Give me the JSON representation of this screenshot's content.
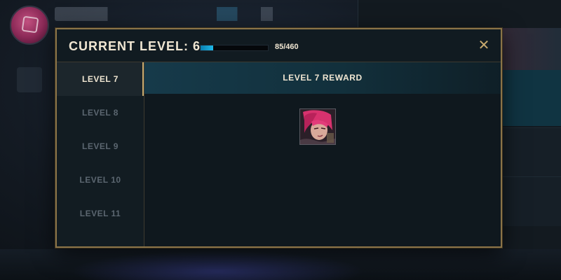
{
  "modal": {
    "title": "CURRENT LEVEL: 6",
    "xp": {
      "current": 85,
      "max": 460,
      "fraction": 0.185,
      "label": "85/460"
    },
    "close_icon": "close-icon"
  },
  "levels": [
    {
      "label": "LEVEL 7",
      "active": true
    },
    {
      "label": "LEVEL 8",
      "active": false
    },
    {
      "label": "LEVEL 9",
      "active": false
    },
    {
      "label": "LEVEL 10",
      "active": false
    },
    {
      "label": "LEVEL 11",
      "active": false
    }
  ],
  "reward": {
    "header": "LEVEL 7 REWARD",
    "item_icon": "champion-portrait-icon"
  },
  "colors": {
    "gold_border": "#8b7448",
    "accent_blue": "#1eb8e8",
    "text_light": "#f0e6d2",
    "text_muted": "#5b6670"
  }
}
